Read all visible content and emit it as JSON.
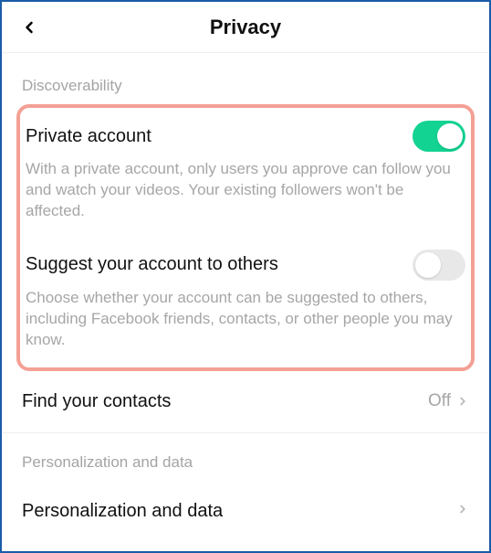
{
  "header": {
    "title": "Privacy"
  },
  "sections": {
    "discoverability": {
      "label": "Discoverability",
      "private_account": {
        "title": "Private account",
        "desc": "With a private account, only users you approve can follow you and watch your videos. Your existing followers won't be affected.",
        "on": true
      },
      "suggest": {
        "title": "Suggest your account to others",
        "desc": "Choose whether your account can be suggested to others, including Facebook friends, contacts, or other people you may know.",
        "on": false
      },
      "contacts": {
        "title": "Find your contacts",
        "value": "Off"
      }
    },
    "personalization": {
      "label": "Personalization and data",
      "row": {
        "title": "Personalization and data"
      }
    }
  }
}
